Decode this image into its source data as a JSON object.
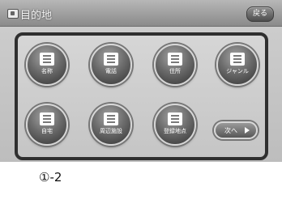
{
  "window": {
    "title": "目的地",
    "back_label": "戻る"
  },
  "menu": {
    "items": [
      {
        "id": "name",
        "label": "名称"
      },
      {
        "id": "phone",
        "label": "電話"
      },
      {
        "id": "address",
        "label": "住所"
      },
      {
        "id": "genre",
        "label": "ジャンル"
      },
      {
        "id": "home",
        "label": "自宅"
      },
      {
        "id": "recent",
        "label": "周辺施設"
      },
      {
        "id": "registered",
        "label": "登録地点"
      }
    ],
    "next_label": "次へ"
  },
  "callout": {
    "label": "①-2"
  }
}
